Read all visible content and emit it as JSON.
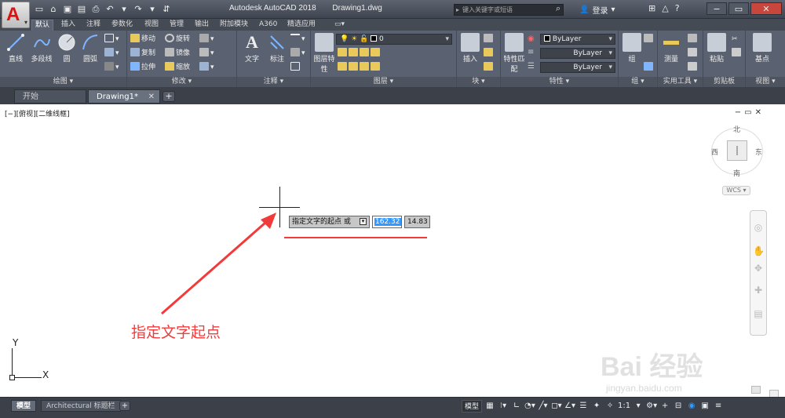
{
  "app": {
    "logo_letter": "A",
    "title": "Autodesk AutoCAD 2018",
    "document": "Drawing1.dwg",
    "search_placeholder": "键入关键字或短语",
    "login": "登录"
  },
  "ribbon_tabs": [
    "默认",
    "插入",
    "注释",
    "参数化",
    "视图",
    "管理",
    "输出",
    "附加模块",
    "A360",
    "精选应用",
    "▭▾"
  ],
  "panels": {
    "draw": {
      "label": "绘图 ▾",
      "tools": [
        "直线",
        "多段线",
        "圆",
        "圆弧"
      ]
    },
    "modify": {
      "label": "修改 ▾",
      "tools": [
        "移动",
        "旋转",
        "复制",
        "镜像",
        "拉伸",
        "缩放"
      ]
    },
    "annotation": {
      "label": "注释 ▾",
      "tools": [
        "文字",
        "标注"
      ]
    },
    "layers": {
      "label": "图层 ▾",
      "tools": [
        "图层特性"
      ],
      "current_layer": "0"
    },
    "block": {
      "label": "块 ▾",
      "tools": [
        "插入"
      ]
    },
    "properties": {
      "label": "特性 ▾",
      "tools": [
        "特性匹配"
      ],
      "color": "ByLayer",
      "linetype": "ByLayer",
      "lineweight": "ByLayer"
    },
    "groups": {
      "label": "组 ▾",
      "tools": [
        "组"
      ]
    },
    "utilities": {
      "label": "实用工具 ▾",
      "tools": [
        "测量"
      ]
    },
    "clipboard": {
      "label": "剪贴板",
      "tools": [
        "粘贴"
      ]
    },
    "view": {
      "label": "视图 ▾",
      "tools": [
        "基点"
      ]
    }
  },
  "file_tabs": [
    {
      "label": "开始",
      "active": false
    },
    {
      "label": "Drawing1*",
      "active": true
    }
  ],
  "viewport": {
    "label": "[−][俯视][二维线框]",
    "viewcube": {
      "north": "北",
      "south": "南",
      "east": "东",
      "west": "西",
      "coord_system": "WCS"
    }
  },
  "dynamic_input": {
    "prompt": "指定文字的起点 或",
    "x_value": "162.32",
    "y_value": "14.83"
  },
  "annotation_text": "指定文字起点",
  "ucs": {
    "x_label": "X",
    "y_label": "Y"
  },
  "layout_tabs": [
    {
      "label": "模型",
      "active": true
    },
    {
      "label": "Architectural 标题栏",
      "active": false
    }
  ],
  "status": {
    "model_label": "模型",
    "scale": "1:1"
  },
  "watermark": {
    "text": "Bai 经验",
    "sub": "jingyan.baidu.com"
  },
  "colors": {
    "annotation_red": "#f23a3a",
    "highlight_blue": "#3399ff",
    "ribbon_bg": "#5a6170"
  }
}
